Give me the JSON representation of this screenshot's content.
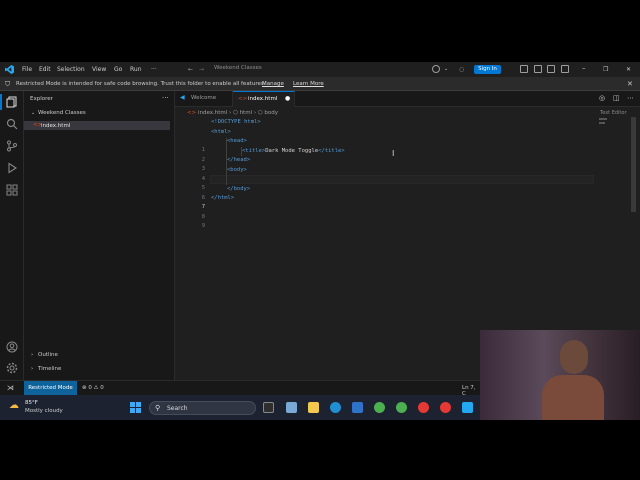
{
  "titlebar": {
    "menus": [
      "File",
      "Edit",
      "Selection",
      "View",
      "Go",
      "Run",
      "···"
    ],
    "search": "Weekend Classes",
    "sign_in": "Sign In"
  },
  "banner": {
    "text": "Restricted Mode is intended for safe code browsing. Trust this folder to enable all features.",
    "manage": "Manage",
    "learn_more": "Learn More"
  },
  "sidebar": {
    "title": "Explorer",
    "more": "···",
    "folder": "Weekend Classes",
    "file": "index.html",
    "outline": "Outline",
    "timeline": "Timeline"
  },
  "editor": {
    "tabs": [
      {
        "label": "Welcome",
        "icon": "vscode-icon"
      },
      {
        "label": "index.html",
        "icon": "html-icon",
        "modified": true
      }
    ],
    "breadcrumb": [
      "index.html",
      "html",
      "body"
    ],
    "text_editor_label": "Text Editor",
    "line_numbers": [
      "1",
      "2",
      "3",
      "4",
      "5",
      "6",
      "7",
      "8",
      "9"
    ],
    "lines": {
      "l1a": "<!DOCTYPE html>",
      "l2a": "<html>",
      "l3a": "<head>",
      "l4a": "<title>",
      "l4b": "Dark Mode Toggle",
      "l4c": "</title>",
      "l5a": "</head>",
      "l6a": "<body>",
      "l8a": "</body>",
      "l9a": "</html>"
    }
  },
  "statusbar": {
    "mode": "Restricted Mode",
    "errors": "⊗ 0 ⚠ 0",
    "position": "Ln 7, C"
  },
  "taskbar": {
    "temp": "85°F",
    "weather": "Mostly cloudy",
    "search": "Search"
  },
  "colors": {
    "accent": "#0078d4",
    "tag": "#569cd6",
    "restricted": "#0e639c",
    "background": "#1f1f1f"
  }
}
